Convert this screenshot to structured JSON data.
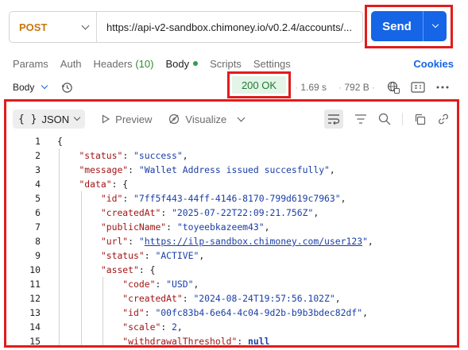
{
  "request": {
    "method": "POST",
    "url": "https://api-v2-sandbox.chimoney.io/v0.2.4/accounts/...",
    "send_label": "Send"
  },
  "tabs": [
    {
      "label": "Params"
    },
    {
      "label": "Auth"
    },
    {
      "label": "Headers",
      "count": "(10)"
    },
    {
      "label": "Body"
    },
    {
      "label": "Scripts"
    },
    {
      "label": "Settings"
    }
  ],
  "cookies_label": "Cookies",
  "response": {
    "body_selector": "Body",
    "status": "200 OK",
    "time": "1.69 s",
    "size": "792 B"
  },
  "toolbar": {
    "format": "JSON",
    "format_braces": "{ }",
    "preview": "Preview",
    "visualize": "Visualize"
  },
  "code_lines": [
    {
      "n": "1",
      "indent": 0,
      "parts": [
        [
          "p",
          "{"
        ]
      ]
    },
    {
      "n": "2",
      "indent": 1,
      "parts": [
        [
          "k",
          "\"status\""
        ],
        [
          "p",
          ": "
        ],
        [
          "s",
          "\"success\""
        ],
        [
          "p",
          ","
        ]
      ]
    },
    {
      "n": "3",
      "indent": 1,
      "parts": [
        [
          "k",
          "\"message\""
        ],
        [
          "p",
          ": "
        ],
        [
          "s",
          "\"Wallet Address issued succesfully\""
        ],
        [
          "p",
          ","
        ]
      ]
    },
    {
      "n": "4",
      "indent": 1,
      "parts": [
        [
          "k",
          "\"data\""
        ],
        [
          "p",
          ": {"
        ]
      ]
    },
    {
      "n": "5",
      "indent": 2,
      "parts": [
        [
          "k",
          "\"id\""
        ],
        [
          "p",
          ": "
        ],
        [
          "s",
          "\"7ff5f443-44ff-4146-8170-799d619c7963\""
        ],
        [
          "p",
          ","
        ]
      ]
    },
    {
      "n": "6",
      "indent": 2,
      "parts": [
        [
          "k",
          "\"createdAt\""
        ],
        [
          "p",
          ": "
        ],
        [
          "s",
          "\"2025-07-22T22:09:21.756Z\""
        ],
        [
          "p",
          ","
        ]
      ]
    },
    {
      "n": "7",
      "indent": 2,
      "parts": [
        [
          "k",
          "\"publicName\""
        ],
        [
          "p",
          ": "
        ],
        [
          "s",
          "\"toyeebkazeem43\""
        ],
        [
          "p",
          ","
        ]
      ]
    },
    {
      "n": "8",
      "indent": 2,
      "parts": [
        [
          "k",
          "\"url\""
        ],
        [
          "p",
          ": "
        ],
        [
          "s",
          "\""
        ],
        [
          "u",
          "https://ilp-sandbox.chimoney.com/user123"
        ],
        [
          "s",
          "\""
        ],
        [
          "p",
          ","
        ]
      ]
    },
    {
      "n": "9",
      "indent": 2,
      "parts": [
        [
          "k",
          "\"status\""
        ],
        [
          "p",
          ": "
        ],
        [
          "s",
          "\"ACTIVE\""
        ],
        [
          "p",
          ","
        ]
      ]
    },
    {
      "n": "10",
      "indent": 2,
      "parts": [
        [
          "k",
          "\"asset\""
        ],
        [
          "p",
          ": {"
        ]
      ]
    },
    {
      "n": "11",
      "indent": 3,
      "parts": [
        [
          "k",
          "\"code\""
        ],
        [
          "p",
          ": "
        ],
        [
          "s",
          "\"USD\""
        ],
        [
          "p",
          ","
        ]
      ]
    },
    {
      "n": "12",
      "indent": 3,
      "parts": [
        [
          "k",
          "\"createdAt\""
        ],
        [
          "p",
          ": "
        ],
        [
          "s",
          "\"2024-08-24T19:57:56.102Z\""
        ],
        [
          "p",
          ","
        ]
      ]
    },
    {
      "n": "13",
      "indent": 3,
      "parts": [
        [
          "k",
          "\"id\""
        ],
        [
          "p",
          ": "
        ],
        [
          "s",
          "\"00fc83b4-6e64-4c04-9d2b-b9b3bdec82df\""
        ],
        [
          "p",
          ","
        ]
      ]
    },
    {
      "n": "14",
      "indent": 3,
      "parts": [
        [
          "k",
          "\"scale\""
        ],
        [
          "p",
          ": "
        ],
        [
          "n",
          "2"
        ],
        [
          "p",
          ","
        ]
      ]
    },
    {
      "n": "15",
      "indent": 3,
      "parts": [
        [
          "k",
          "\"withdrawalThreshold\""
        ],
        [
          "p",
          ": "
        ],
        [
          "kw",
          "null"
        ]
      ]
    }
  ],
  "colors": {
    "send_button": "#1565e6",
    "status_ok_bg": "#e4f4e7",
    "status_ok_text": "#1f7a36",
    "method_post": "#c7780f",
    "highlight_border": "#e11c1c",
    "json_key": "#a11515",
    "json_string": "#1a3ea6"
  },
  "icons": [
    "chevron-down-icon",
    "history-icon",
    "network-globe-icon",
    "example-icon",
    "more-icon",
    "preview-play-icon",
    "visualize-icon",
    "wrap-lines-icon",
    "filter-icon",
    "search-icon",
    "copy-icon",
    "link-icon"
  ]
}
